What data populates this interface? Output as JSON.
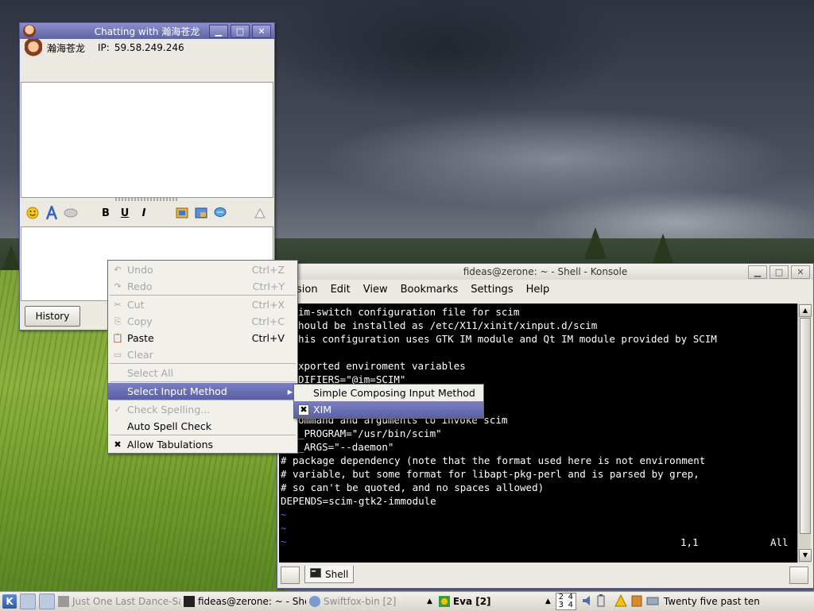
{
  "chat": {
    "title": "Chatting with 瀚海苍龙",
    "contact_name": "瀚海苍龙",
    "ip_label": "IP:",
    "ip_value": "59.58.249.246",
    "history_label": "History",
    "toolbar": {
      "bold": "B",
      "underline": "U",
      "italic": "I"
    }
  },
  "window_buttons": {
    "minimize": "▁",
    "maximize": "□",
    "close": "✕"
  },
  "konsole": {
    "title": "fideas@zerone: ~ - Shell - Konsole",
    "menu": [
      "Session",
      "Edit",
      "View",
      "Bookmarks",
      "Settings",
      "Help"
    ],
    "menu_visible": [
      "sion",
      "Edit",
      "View",
      "Bookmarks",
      "Settings",
      "Help"
    ],
    "lines": [
      "im-switch configuration file for scim",
      "hould be installed as /etc/X11/xinit/xinput.d/scim",
      "his configuration uses GTK IM module and Qt IM module provided by SCIM",
      "",
      "xported enviroment variables",
      "DIFIERS=\"@im=SCIM\"",
      "",
      "",
      "ommand and arguments to invoke scim",
      "_PROGRAM=\"/usr/bin/scim\"",
      "_ARGS=\"--daemon\"",
      "# package dependency (note that the format used here is not environment",
      "# variable, but some format for libapt-pkg-perl and is parsed by grep,",
      "# so can't be quoted, and no spaces allowed)",
      "DEPENDS=scim-gtk2-immodule",
      "~",
      "~",
      "~"
    ],
    "status_pos": "1,1",
    "status_all": "All",
    "tab_label": "Shell"
  },
  "context_menu": {
    "items": [
      {
        "label": "Undo",
        "shortcut": "Ctrl+Z",
        "disabled": true
      },
      {
        "label": "Redo",
        "shortcut": "Ctrl+Y",
        "disabled": true
      },
      {
        "label": "Cut",
        "shortcut": "Ctrl+X",
        "disabled": true
      },
      {
        "label": "Copy",
        "shortcut": "Ctrl+C",
        "disabled": true
      },
      {
        "label": "Paste",
        "shortcut": "Ctrl+V",
        "disabled": false
      },
      {
        "label": "Clear",
        "shortcut": "",
        "disabled": true
      },
      {
        "label": "Select All",
        "shortcut": "",
        "disabled": true
      },
      {
        "label": "Select Input Method",
        "shortcut": "",
        "disabled": false,
        "highlighted": true
      },
      {
        "label": "Check Spelling...",
        "shortcut": "",
        "disabled": true
      },
      {
        "label": "Auto Spell Check",
        "shortcut": "",
        "disabled": false
      },
      {
        "label": "Allow Tabulations",
        "shortcut": "",
        "disabled": false,
        "checked": true
      }
    ],
    "submenu": [
      {
        "label": "Simple Composing Input Method",
        "checked": false
      },
      {
        "label": "XIM",
        "checked": true,
        "highlighted": true
      }
    ],
    "submenu_arrow": "▸"
  },
  "taskbar": {
    "kmenu_label": "K",
    "tasks": [
      {
        "label": "Just One Last Dance-Sa"
      },
      {
        "label": "fideas@zerone: ~ - She"
      },
      {
        "label": "Swiftfox-bin [2]"
      },
      {
        "label": "Eva [2]"
      }
    ],
    "pager": [
      "2",
      "4",
      "3",
      "4"
    ],
    "clock": "Twenty five past ten"
  },
  "colors": {
    "title_gradient_top": "#8a8fcb",
    "title_gradient_bottom": "#5e63a5",
    "menu_highlight": "#6a6fb5",
    "terminal_bg": "#000000",
    "terminal_fg": "#ffffff",
    "vim_tilde": "#4c5cff"
  }
}
